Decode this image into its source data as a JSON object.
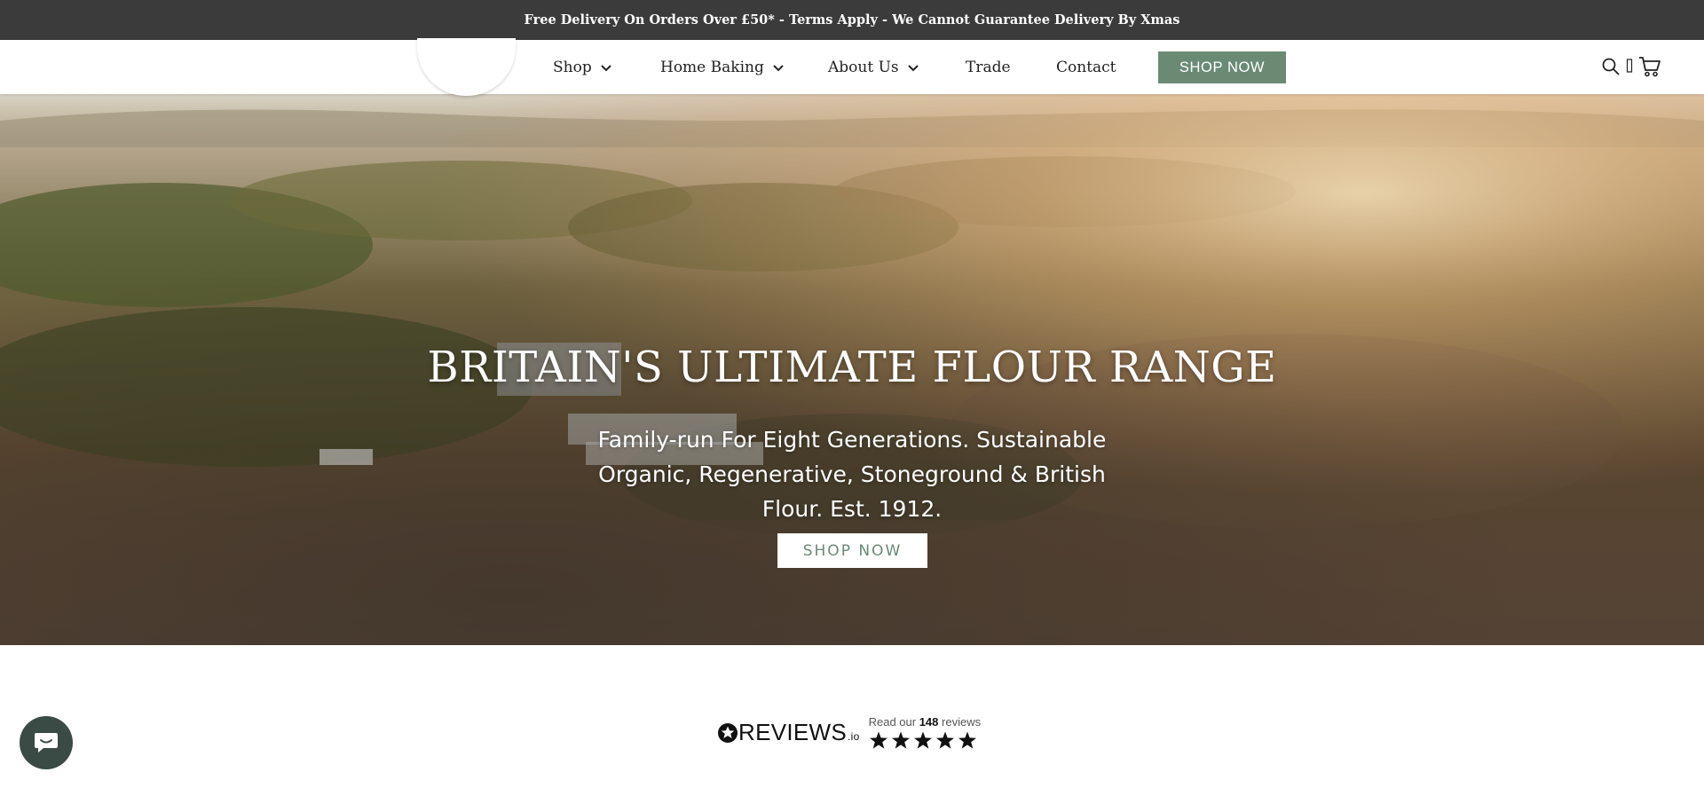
{
  "announcement": "Free Delivery On Orders Over £50* - Terms Apply - We Cannot Guarantee Delivery By Xmas",
  "nav": {
    "items": [
      {
        "label": "Shop",
        "dropdown": true
      },
      {
        "label": "Home Baking",
        "dropdown": true
      },
      {
        "label": "About Us",
        "dropdown": true
      },
      {
        "label": "Trade",
        "dropdown": false
      },
      {
        "label": "Contact",
        "dropdown": false
      }
    ],
    "cta_label": "SHOP NOW",
    "icons": [
      "search-icon",
      "account-icon",
      "cart-icon"
    ]
  },
  "hero": {
    "title": "BRITAIN'S ULTIMATE FLOUR RANGE",
    "subtitle": "Family-run For Eight Generations. Sustainable Organic, Regenerative, Stoneground & British Flour. Est. 1912.",
    "button_label": "SHOP NOW"
  },
  "reviews": {
    "brand": "REVIEWS",
    "brand_suffix": ".io",
    "read_prefix": "Read our",
    "count": "148",
    "read_suffix": "reviews",
    "rating_stars": 5
  },
  "colors": {
    "announcement_bg": "#3b3b3b",
    "accent": "#6a8a74",
    "chat_bubble": "#3a4a44"
  }
}
